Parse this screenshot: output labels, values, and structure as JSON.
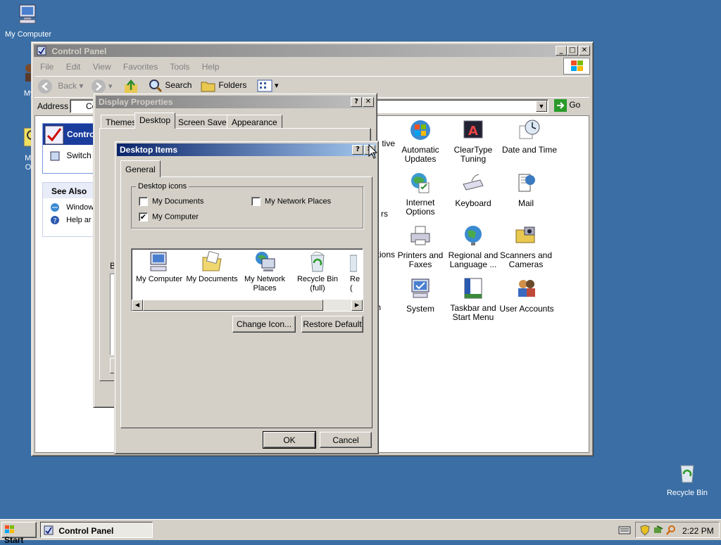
{
  "desktop": {
    "icons": [
      {
        "label": "My Computer"
      },
      {
        "label": "MyPa"
      },
      {
        "label": "Micro\nOutlo"
      },
      {
        "label": "Recycle Bin"
      }
    ]
  },
  "control_panel": {
    "title": "Control Panel",
    "menu": [
      "File",
      "Edit",
      "View",
      "Favorites",
      "Tools",
      "Help"
    ],
    "toolbar": {
      "back": "Back",
      "search": "Search",
      "folders": "Folders"
    },
    "address_label": "Address",
    "address_value": "Co",
    "go_label": "Go",
    "sidebar": {
      "panel_title": "Contro",
      "switch_label": "Switch",
      "see_also": "See Also",
      "links": [
        "Window",
        "Help ar"
      ]
    },
    "items": [
      {
        "label": "tive"
      },
      {
        "label": "Automatic\nUpdates"
      },
      {
        "label": "ClearType\nTuning"
      },
      {
        "label": "Date and Time"
      },
      {
        "label": "rs"
      },
      {
        "label": "Internet\nOptions"
      },
      {
        "label": "Keyboard"
      },
      {
        "label": "Mail"
      },
      {
        "label": "tions"
      },
      {
        "label": "Printers and\nFaxes"
      },
      {
        "label": "Regional and\nLanguage ..."
      },
      {
        "label": "Scanners and\nCameras"
      },
      {
        "label": "n"
      },
      {
        "label": "System"
      },
      {
        "label": "Taskbar and\nStart Menu"
      },
      {
        "label": "User Accounts"
      }
    ]
  },
  "display_properties": {
    "title": "Display Properties",
    "tabs": [
      "Themes",
      "Desktop",
      "Screen Saver",
      "Appearance"
    ],
    "partial_label": "B"
  },
  "desktop_items": {
    "title": "Desktop Items",
    "tab": "General",
    "group_label": "Desktop icons",
    "checkboxes": [
      {
        "label": "My Documents",
        "checked": false
      },
      {
        "label": "My Network Places",
        "checked": false
      },
      {
        "label": "My Computer",
        "checked": true
      }
    ],
    "icons": [
      {
        "label": "My Computer"
      },
      {
        "label": "My Documents"
      },
      {
        "label": "My Network\nPlaces"
      },
      {
        "label": "Recycle Bin\n(full)"
      },
      {
        "label": "Re\n("
      }
    ],
    "change_icon": "Change Icon...",
    "restore_default": "Restore Default",
    "ok": "OK",
    "cancel": "Cancel",
    "check_mark": "✔"
  },
  "taskbar": {
    "start": "Start",
    "task": "Control Panel",
    "clock": "2:22 PM"
  }
}
